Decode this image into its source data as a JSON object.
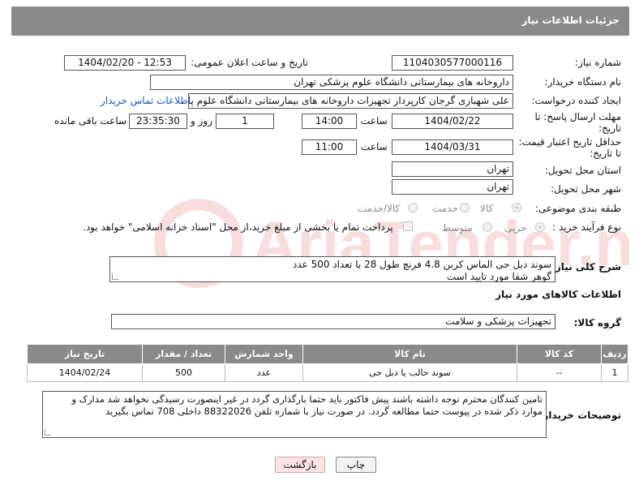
{
  "header": {
    "title": "جزئیات اطلاعات نیاز"
  },
  "form": {
    "need_number": {
      "label": "شماره نیاز:",
      "value": "1104030577000116"
    },
    "announce_datetime": {
      "label": "تاریخ و ساعت اعلان عمومی:",
      "value": "1404/02/20 - 12:53"
    },
    "buyer_org": {
      "label": "نام دستگاه خریدار:",
      "value": "داروخانه های بیمارستانی دانشگاه علوم پزشکی تهران"
    },
    "requester": {
      "label": "ایجاد کننده درخواست:",
      "value": "علی شهبازی گرجان کارپرداز تجهیزات داروخانه های بیمارستانی دانشگاه علوم پزشکی تهران",
      "contact_link": "اطلاعات تماس خریدار"
    },
    "reply_deadline": {
      "label_line1": "مهلت ارسال پاسخ: تا",
      "label_line2": "تاریخ:",
      "date": "1404/02/22",
      "time_label": "ساعت",
      "time": "14:00",
      "days": "1",
      "days_label": "روز و",
      "remaining": "23:35:30",
      "remaining_label": "ساعت باقی مانده"
    },
    "price_validity": {
      "label_line1": "حداقل تاریخ اعتبار قیمت:",
      "label_line2": "تا تاریخ:",
      "date": "1404/03/31",
      "time_label": "ساعت",
      "time": "11:00"
    },
    "delivery_province": {
      "label": "استان محل تحویل:",
      "value": "تهران"
    },
    "delivery_city": {
      "label": "شهر محل تحویل:",
      "value": "تهران"
    },
    "category": {
      "label": "طبقه بندی موضوعی:",
      "options": [
        "کالا",
        "خدمت",
        "کالا/خدمت"
      ],
      "selected": "کالا"
    },
    "purchase_process": {
      "label": "نوع فرآیند خرید :",
      "options": [
        "جزیی",
        "متوسط"
      ],
      "selected": "جزیی",
      "payment_note": "پرداخت تمام یا بخشی از مبلغ خرید،از محل \"اسناد خزانه اسلامی\" خواهد بود."
    }
  },
  "general_description": {
    "label": "شرح کلی نیاز:",
    "line1": "سوند دبل جی الماس کربن 4.8 فرنچ طول 28 با تعداد 500 عدد",
    "line2": "گوهر شفا مورد تایید است"
  },
  "goods_section": {
    "title": "اطلاعات کالاهای مورد نیاز",
    "group_label": "گروه کالا:",
    "group_value": "تجهیزات پزشکی و سلامت"
  },
  "table": {
    "headers": [
      "ردیف",
      "کد کالا",
      "نام کالا",
      "واحد شمارش",
      "تعداد / مقدار",
      "تاریخ نیاز"
    ],
    "rows": [
      [
        "1",
        "--",
        "سوند حالب یا دبل جی",
        "عدد",
        "500",
        "1404/02/24"
      ]
    ]
  },
  "buyer_notes": {
    "label": "توضیحات خریدار:",
    "line1": "تامین کنندگان محترم توجه داشته باشند پیش فاکتور باید حتما بارگذاری گردد در غیر اینصورت رسیدگی نخواهد شد مدارک و",
    "line2": "موارد ذکر شده در پیوست حتما مطالعه گردد. در صورت نیاز با شماره تلفن 88322026 داخلی 708 تماس بگیرید"
  },
  "buttons": {
    "print": "چاپ",
    "back": "بازگشت"
  },
  "watermark": {
    "text": "AriaTender.net"
  },
  "colors": {
    "header": "#8a8a8a",
    "link": "#1a56c4",
    "back_button": "#fbe4e4"
  }
}
